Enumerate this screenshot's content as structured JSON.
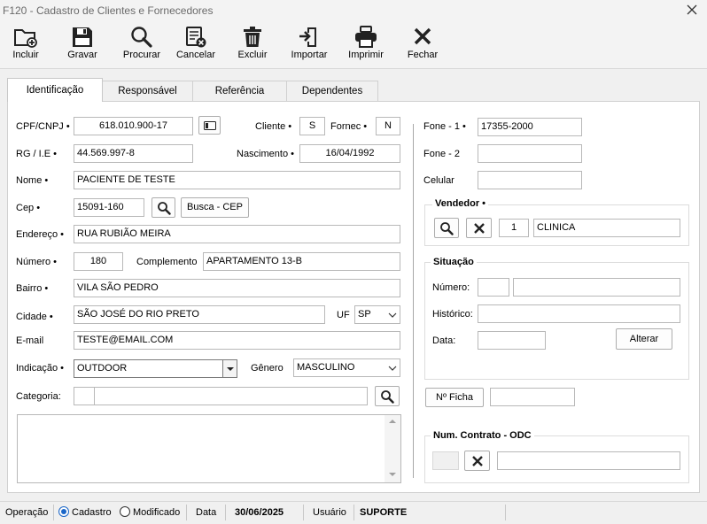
{
  "window": {
    "title": "F120 - Cadastro de Clientes e Fornecedores"
  },
  "toolbar": {
    "buttons": [
      {
        "label": "Incluir",
        "icon": "folder-plus-icon"
      },
      {
        "label": "Gravar",
        "icon": "floppy-disk-icon"
      },
      {
        "label": "Procurar",
        "icon": "magnifier-icon"
      },
      {
        "label": "Cancelar",
        "icon": "cancel-document-icon"
      },
      {
        "label": "Excluir",
        "icon": "trash-icon"
      },
      {
        "label": "Importar",
        "icon": "import-icon"
      },
      {
        "label": "Imprimir",
        "icon": "printer-icon"
      },
      {
        "label": "Fechar",
        "icon": "close-x-icon"
      }
    ]
  },
  "tabs": [
    {
      "label": "Identificação",
      "active": true
    },
    {
      "label": "Responsável",
      "active": false
    },
    {
      "label": "Referência",
      "active": false
    },
    {
      "label": "Dependentes",
      "active": false
    }
  ],
  "form": {
    "cpf_label": "CPF/CNPJ •",
    "cpf_value": "618.010.900-17",
    "cliente_label": "Cliente •",
    "cliente_value": "S",
    "fornec_label": "Fornec •",
    "fornec_value": "N",
    "rg_label": "RG / I.E •",
    "rg_value": "44.569.997-8",
    "nascimento_label": "Nascimento •",
    "nascimento_value": "16/04/1992",
    "nome_label": "Nome •",
    "nome_value": "PACIENTE DE TESTE",
    "cep_label": "Cep •",
    "cep_value": "15091-160",
    "busca_cep_label": "Busca - CEP",
    "endereco_label": "Endereço •",
    "endereco_value": "RUA RUBIÃO MEIRA",
    "numero_label": "Número •",
    "numero_value": "180",
    "complemento_label": "Complemento",
    "complemento_value": "APARTAMENTO 13-B",
    "bairro_label": "Bairro •",
    "bairro_value": "VILA SÃO PEDRO",
    "cidade_label": "Cidade •",
    "cidade_value": "SÃO JOSÉ DO RIO PRETO",
    "uf_label": "UF",
    "uf_value": "SP",
    "email_label": "E-mail",
    "email_value": "TESTE@EMAIL.COM",
    "indicacao_label": "Indicação •",
    "indicacao_value": "OUTDOOR",
    "genero_label": "Gênero",
    "genero_value": "MASCULINO",
    "categoria_label": "Categoria:",
    "categoria_code": "",
    "categoria_value": "",
    "observacoes_value": ""
  },
  "right": {
    "fone1_label": "Fone - 1 •",
    "fone1_value": "17355-2000",
    "fone2_label": "Fone - 2",
    "fone2_value": "",
    "celular_label": "Celular",
    "celular_value": "",
    "vendedor": {
      "title": "Vendedor •",
      "code": "1",
      "name": "CLINICA"
    },
    "situacao": {
      "title": "Situação",
      "numero_label": "Número:",
      "numero_code": "",
      "numero_value": "",
      "historico_label": "Histórico:",
      "historico_value": "",
      "data_label": "Data:",
      "data_value": "",
      "alterar_label": "Alterar"
    },
    "ficha_label": "Nº Ficha",
    "ficha_value": "",
    "contrato": {
      "title": "Num. Contrato - ODC",
      "code": "",
      "value": ""
    }
  },
  "statusbar": {
    "operacao_label": "Operação",
    "cadastro_label": "Cadastro",
    "modificado_label": "Modificado",
    "selected": "Cadastro",
    "data_label": "Data",
    "data_value": "30/06/2025",
    "usuario_label": "Usuário",
    "usuario_value": "SUPORTE"
  },
  "colors": {
    "accent": "#1a66c8",
    "background": "#f0f0f0",
    "panel": "#ffffff"
  }
}
